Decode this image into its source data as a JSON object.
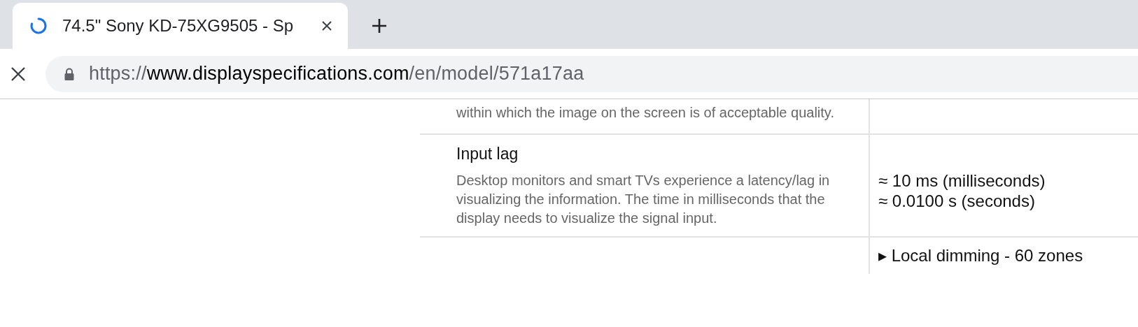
{
  "browser": {
    "tab": {
      "title": "74.5\" Sony KD-75XG9505 - Sp",
      "loading": true
    },
    "address": {
      "secure": true,
      "scheme": "https://",
      "host": "www.displayspecifications.com",
      "path": "/en/model/571a17aa"
    }
  },
  "spec_rows": [
    {
      "description": "within which the image on the screen is of acceptable quality.",
      "values": []
    },
    {
      "title": "Input lag",
      "description": "Desktop monitors and smart TVs experience a latency/lag in visualizing the information. The time in milliseconds that the display needs to visualize the signal input.",
      "values": [
        "≈ 10 ms (milliseconds)",
        "≈ 0.0100 s (seconds)"
      ]
    }
  ],
  "note": "▸ Local dimming - 60 zones"
}
